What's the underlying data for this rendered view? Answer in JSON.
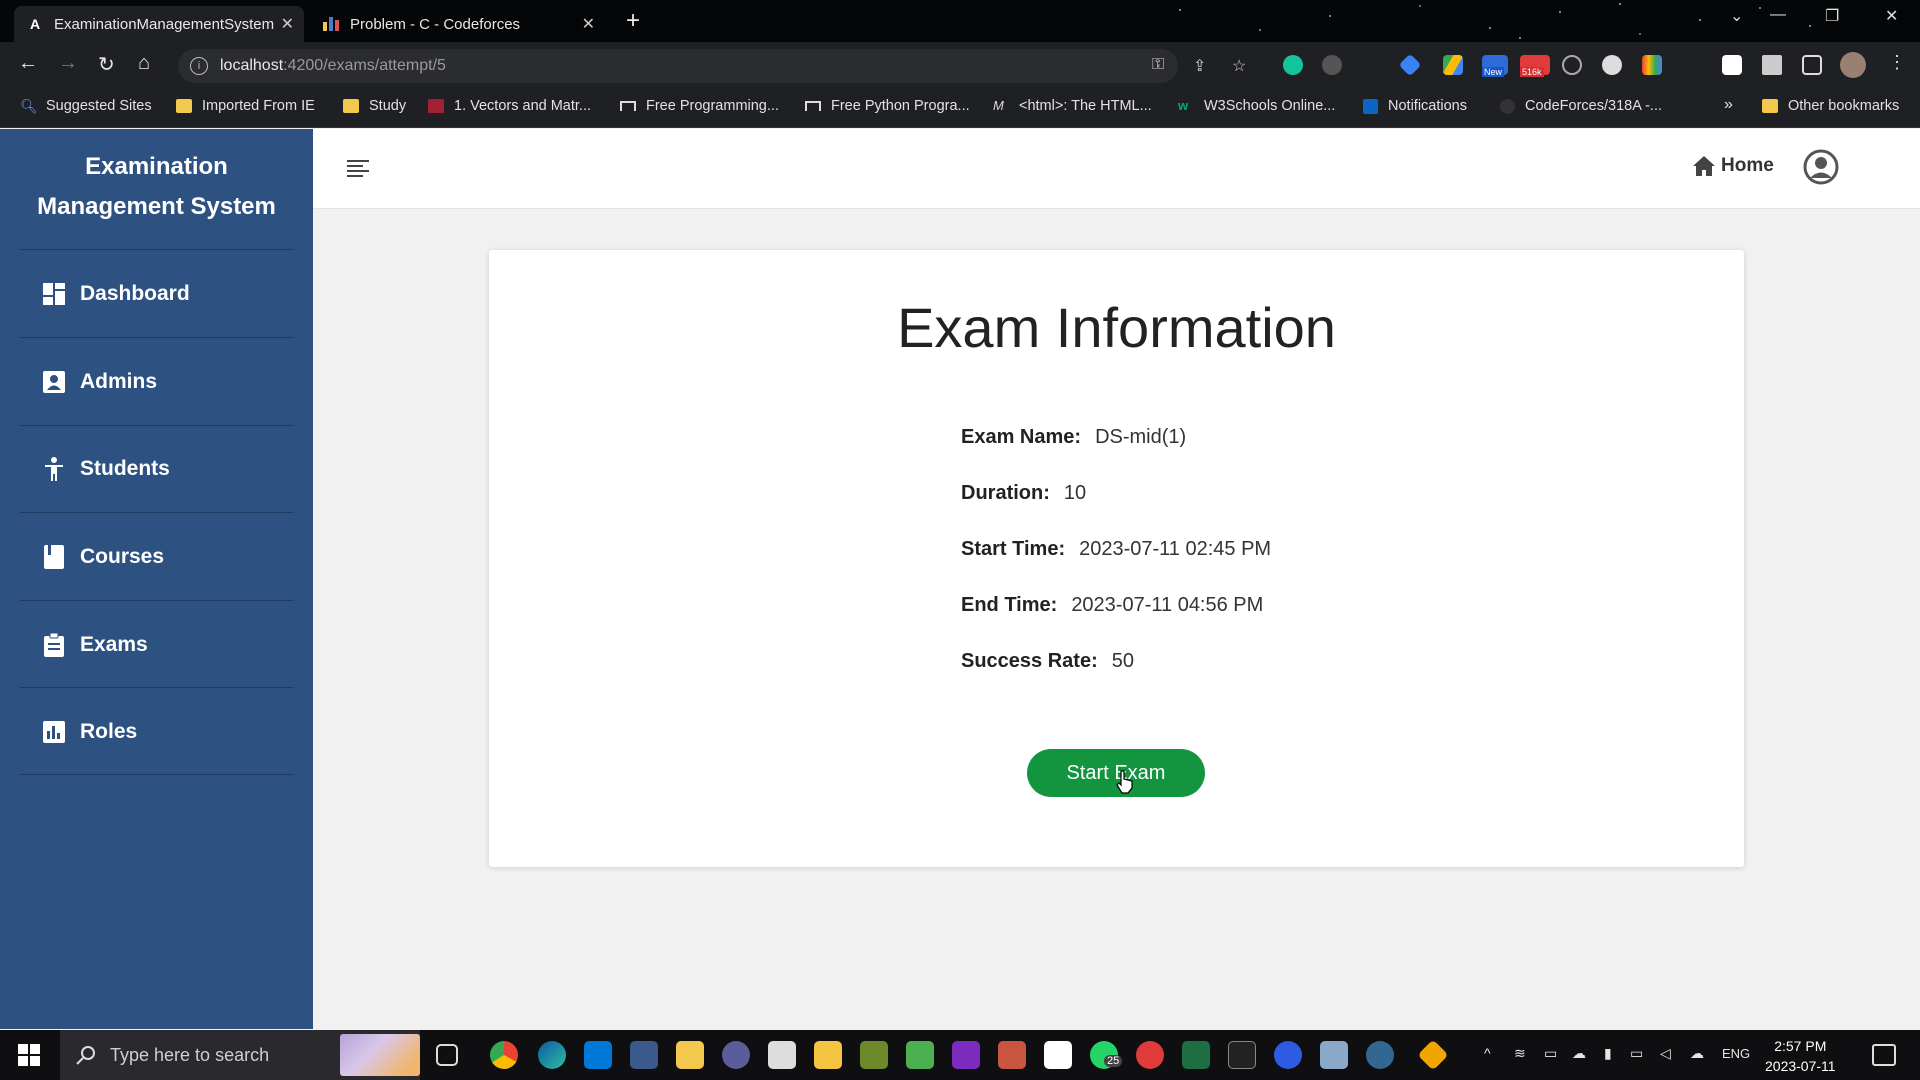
{
  "browser": {
    "tabs": [
      {
        "title": "ExaminationManagementSystem",
        "favicon": "angular-a-icon",
        "active": true
      },
      {
        "title": "Problem - C - Codeforces",
        "favicon": "codeforces-icon",
        "active": false
      }
    ],
    "url_host": "localhost",
    "url_path": ":4200/exams/attempt/5",
    "bookmarks": [
      {
        "label": "Suggested Sites",
        "icon": "search-icon"
      },
      {
        "label": "Imported From IE",
        "icon": "folder-icon"
      },
      {
        "label": "Study",
        "icon": "folder-icon"
      },
      {
        "label": "1. Vectors and Matr...",
        "icon": "mit-icon"
      },
      {
        "label": "Free Programming...",
        "icon": "bookmark-icon"
      },
      {
        "label": "Free Python Progra...",
        "icon": "bookmark-icon"
      },
      {
        "label": "<html>: The HTML...",
        "icon": "mdn-icon"
      },
      {
        "label": "W3Schools Online...",
        "icon": "w3schools-icon"
      },
      {
        "label": "Notifications",
        "icon": "linkedin-icon"
      },
      {
        "label": "CodeForces/318A -...",
        "icon": "github-icon"
      }
    ],
    "bookmarks_more": "»",
    "other_bookmarks": "Other bookmarks",
    "extension_badges": {
      "new": "New",
      "count": "516k"
    }
  },
  "sidebar": {
    "title_line1": "Examination",
    "title_line2": "Management System",
    "items": [
      {
        "label": "Dashboard",
        "icon": "dashboard-icon"
      },
      {
        "label": "Admins",
        "icon": "admin-badge-icon"
      },
      {
        "label": "Students",
        "icon": "person-icon"
      },
      {
        "label": "Courses",
        "icon": "book-icon"
      },
      {
        "label": "Exams",
        "icon": "clipboard-icon"
      },
      {
        "label": "Roles",
        "icon": "chart-icon"
      }
    ]
  },
  "topbar": {
    "home_label": "Home"
  },
  "exam": {
    "heading": "Exam Information",
    "fields": [
      {
        "label": "Exam Name:",
        "value": "DS-mid(1)"
      },
      {
        "label": "Duration:",
        "value": "10"
      },
      {
        "label": "Start Time:",
        "value": "2023-07-11 02:45 PM"
      },
      {
        "label": "End Time:",
        "value": "2023-07-11 04:56 PM"
      },
      {
        "label": "Success Rate:",
        "value": "50"
      }
    ],
    "start_button": "Start Exam"
  },
  "taskbar": {
    "search_placeholder": "Type here to search",
    "whatsapp_badge": "25",
    "language": "ENG",
    "time": "2:57 PM",
    "date": "2023-07-11"
  },
  "colors": {
    "sidebar_bg": "#2d5282",
    "start_button": "#13943f",
    "page_bg": "#f1f1f1"
  }
}
